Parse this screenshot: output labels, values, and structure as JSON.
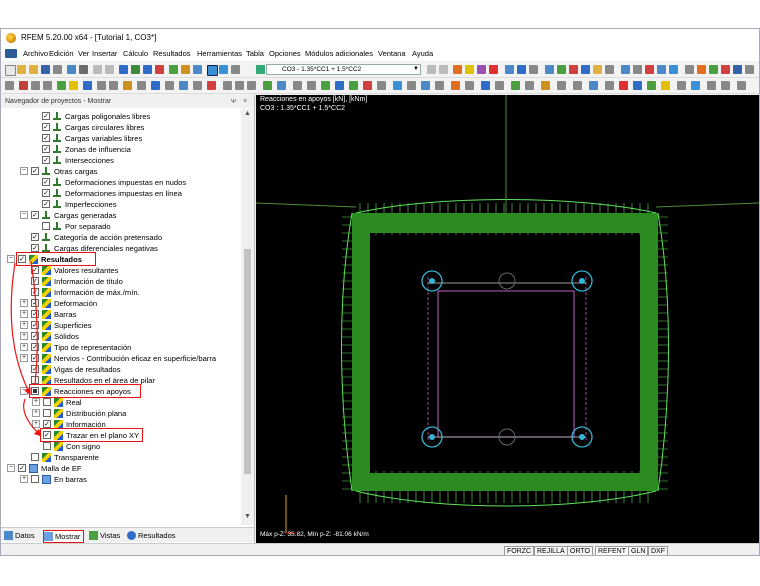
{
  "window": {
    "title": "RFEM 5.20.00 x64 - [Tutorial 1, CO3*]"
  },
  "menu": [
    "Archivo",
    "Edición",
    "Ver",
    "Insertar",
    "Cálculo",
    "Resultados",
    "Herramientas",
    "Tabla",
    "Opciones",
    "Módulos adicionales",
    "Ventana",
    "Ayuda"
  ],
  "toolbar": {
    "combo_value": "CO3 - 1.35*CC1 + 1.5*CC2"
  },
  "navigator": {
    "title": "Navegador de proyectos - Mostrar",
    "pin": "ᴪ",
    "close": "×",
    "rows": [
      {
        "label": "Cargas poligonales libres",
        "icon": "load-icon",
        "check": "checked"
      },
      {
        "label": "Cargas circulares libres",
        "icon": "load-icon",
        "check": "checked"
      },
      {
        "label": "Cargas variables libres",
        "icon": "load-icon",
        "check": "checked"
      },
      {
        "label": "Zonas de influencia",
        "icon": "load-icon",
        "check": "checked"
      },
      {
        "label": "Intersecciones",
        "icon": "load-icon",
        "check": "checked"
      },
      {
        "label": "Otras cargas",
        "icon": "load-icon",
        "check": "checked"
      },
      {
        "label": "Deformaciones impuestas en nudos",
        "icon": "load-icon",
        "check": "checked"
      },
      {
        "label": "Deformaciones impuestas en línea",
        "icon": "load-icon",
        "check": "checked"
      },
      {
        "label": "Imperfecciones",
        "icon": "load-icon",
        "check": "checked"
      },
      {
        "label": "Cargas generadas",
        "icon": "load-icon",
        "check": "checked"
      },
      {
        "label": "Por separado",
        "icon": "load-icon",
        "check": "unchecked"
      },
      {
        "label": "Categoría de acción pretensado",
        "icon": "load-icon",
        "check": "checked"
      },
      {
        "label": "Cargas diferenciales negativas",
        "icon": "load-icon",
        "check": "checked"
      },
      {
        "label": "Resultados",
        "icon": "results-icon",
        "check": "checked"
      },
      {
        "label": "Valores resultantes",
        "icon": "results-icon",
        "check": "checked"
      },
      {
        "label": "Información de título",
        "icon": "results-icon",
        "check": "checked"
      },
      {
        "label": "Información de máx./mín.",
        "icon": "results-icon",
        "check": "checked"
      },
      {
        "label": "Deformación",
        "icon": "results-icon",
        "check": "checked"
      },
      {
        "label": "Barras",
        "icon": "results-icon",
        "check": "checked"
      },
      {
        "label": "Superficies",
        "icon": "results-icon",
        "check": "checked"
      },
      {
        "label": "Sólidos",
        "icon": "results-icon",
        "check": "checked"
      },
      {
        "label": "Tipo de representación",
        "icon": "results-icon",
        "check": "checked"
      },
      {
        "label": "Nervios - Contribución eficaz en superficie/barra",
        "icon": "results-icon",
        "check": "checked"
      },
      {
        "label": "Vigas de resultados",
        "icon": "results-icon",
        "check": "checked"
      },
      {
        "label": "Resultados en el área de pilar",
        "icon": "results-icon",
        "check": "unchecked"
      },
      {
        "label": "Reacciones en apoyos",
        "icon": "results-icon",
        "check": "partial"
      },
      {
        "label": "Real",
        "icon": "results-icon",
        "check": "unchecked"
      },
      {
        "label": "Distribución plana",
        "icon": "results-icon",
        "check": "unchecked"
      },
      {
        "label": "Información",
        "icon": "results-icon",
        "check": "checked"
      },
      {
        "label": "Trazar en el plano XY",
        "icon": "results-icon",
        "check": "checked"
      },
      {
        "label": "Con signo",
        "icon": "results-icon",
        "check": "unchecked"
      },
      {
        "label": "Transparente",
        "icon": "results-icon",
        "check": "unchecked"
      },
      {
        "label": "Malla de EF",
        "icon": "mesh-icon",
        "check": "checked"
      },
      {
        "label": "En barras",
        "icon": "mesh-icon",
        "check": "unchecked"
      }
    ],
    "tabs": [
      "Datos",
      "Mostrar",
      "Vistas",
      "Resultados"
    ]
  },
  "viewport": {
    "title": "Reacciones en apoyos [kN], [kNm]",
    "combo": "CO3 : 1.35*CC1 + 1.5*CC2",
    "minmax": "Máx p-Z: 35.82, Mín p-Z: -81.06 kN/m"
  },
  "statusbar": [
    "FORZC",
    "REJILLA",
    "ORTO",
    "REFENT",
    "GLN",
    "DXF"
  ],
  "colors": {
    "reaction_fill": "#2b8a20",
    "reaction_line": "#5fe35a",
    "highlight": "#ee1111",
    "support": "#35b6d8",
    "slab_outline": "#c060c0"
  }
}
